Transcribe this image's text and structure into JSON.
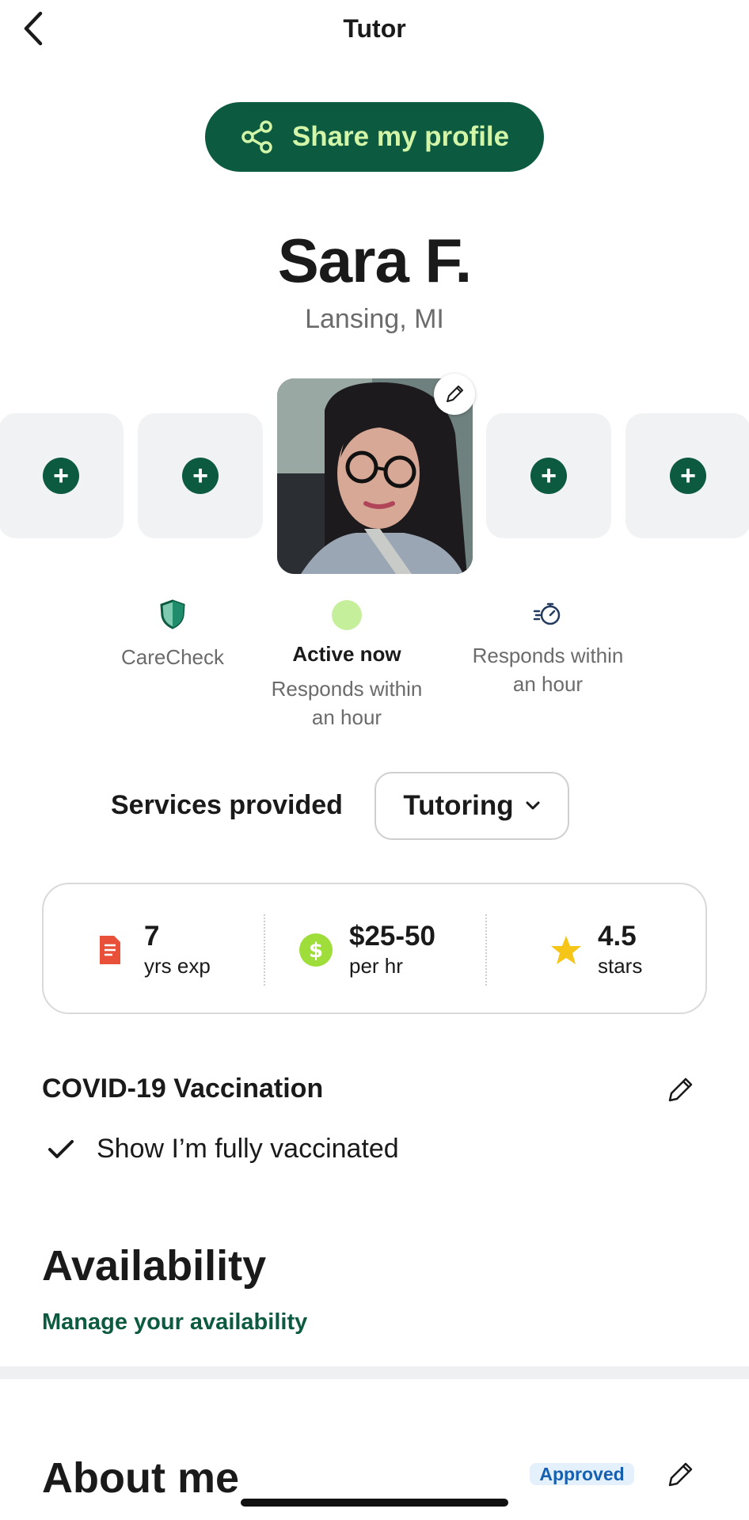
{
  "header": {
    "title": "Tutor",
    "back_icon": "chevron-left-icon"
  },
  "share": {
    "label": "Share my profile",
    "icon": "share-icon"
  },
  "profile": {
    "name": "Sara F.",
    "location": "Lansing, MI"
  },
  "photos": {
    "add_icon": "plus-icon",
    "edit_icon": "pencil-icon"
  },
  "badges": {
    "carecheck": {
      "label": "CareCheck",
      "icon": "shield-icon"
    },
    "active": {
      "title": "Active now",
      "subtitle": "Responds within an hour",
      "icon": "status-dot-icon"
    },
    "responds": {
      "label": "Responds within an hour",
      "icon": "stopwatch-icon"
    }
  },
  "services": {
    "label": "Services provided",
    "selected": "Tutoring"
  },
  "stats": {
    "experience": {
      "value": "7",
      "unit": "yrs exp",
      "icon": "document-icon"
    },
    "rate": {
      "value": "$25-50",
      "unit": "per hr",
      "icon": "dollar-icon"
    },
    "rating": {
      "value": "4.5",
      "unit": "stars",
      "icon": "star-icon"
    }
  },
  "covid": {
    "title": "COVID-19 Vaccination",
    "status": "Show I’m fully vaccinated"
  },
  "availability": {
    "title": "Availability",
    "link": "Manage your availability"
  },
  "about": {
    "title": "About me",
    "badge": "Approved"
  },
  "colors": {
    "brand_green": "#0c5a40",
    "accent_lime": "#d3f5a8",
    "approved_blue": "#1560b0",
    "star_yellow": "#f5c518",
    "doc_red": "#e8503a"
  }
}
